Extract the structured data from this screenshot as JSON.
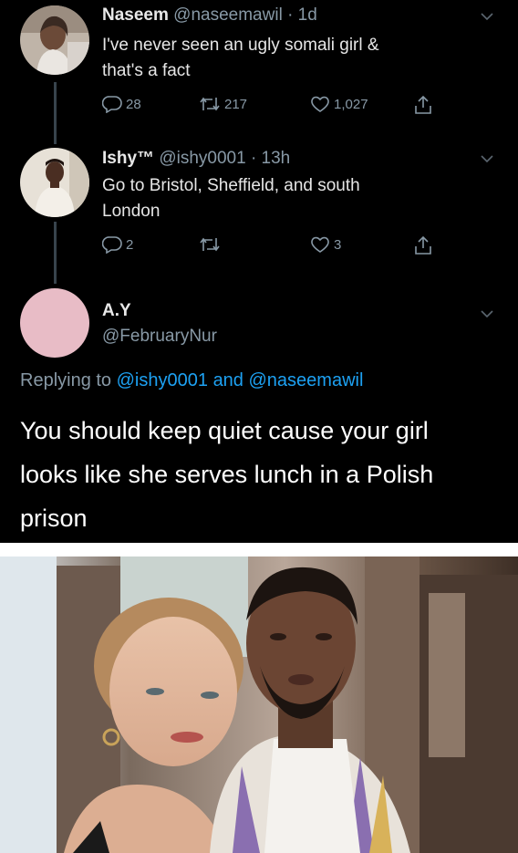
{
  "tweets": [
    {
      "name": "Naseem",
      "handle": "@naseemawil",
      "time": "· 1d",
      "text_lines": [
        "I've never seen an ugly somali girl &",
        "that's a fact"
      ],
      "replies": "28",
      "retweets": "217",
      "likes": "1,027"
    },
    {
      "name": "Ishy™",
      "handle": "@ishy0001",
      "time": "· 13h",
      "text_lines": [
        "Go to Bristol, Sheffield, and south",
        "London"
      ],
      "replies": "2",
      "retweets": "",
      "likes": "3"
    }
  ],
  "reply": {
    "name": "A.Y",
    "handle": "@FebruaryNur",
    "replying_prefix": "Replying to",
    "mention_1": "@ishy0001",
    "replying_and": "and",
    "mention_2": "@naseemawil",
    "text_lines": [
      "You should keep quiet cause your girl",
      "looks like she serves lunch in a Polish",
      "prison"
    ]
  },
  "colors": {
    "background": "#000000",
    "thread_line": "#38444d",
    "secondary_text": "#8899a6",
    "mention": "#1da1f2",
    "avatar_pink": "#e8bcc6"
  },
  "icons": [
    "reply-icon",
    "retweet-icon",
    "like-icon",
    "share-icon",
    "chevron-down-icon"
  ]
}
